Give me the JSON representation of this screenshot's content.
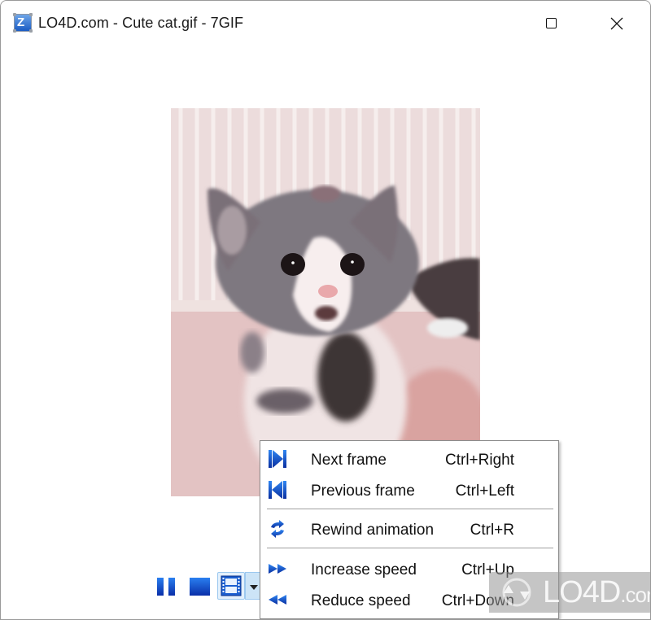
{
  "window": {
    "title": "LO4D.com - Cute cat.gif - 7GIF",
    "app_icon": "7gif-app-icon",
    "controls": [
      {
        "name": "maximize",
        "icon": "maximize-icon"
      },
      {
        "name": "close",
        "icon": "close-icon"
      }
    ]
  },
  "viewer": {
    "image_description": "Animated GIF of a grey and white kitten in front of a white wire cage"
  },
  "toolbar": {
    "buttons": [
      {
        "name": "pause",
        "icon": "pause-icon"
      },
      {
        "name": "stop",
        "icon": "stop-icon"
      },
      {
        "name": "frames",
        "icon": "film-strip-icon",
        "active": true
      },
      {
        "name": "frames-dropdown",
        "icon": "dropdown-arrow-icon"
      }
    ]
  },
  "context_menu": {
    "items": [
      {
        "label": "Next frame",
        "shortcut": "Ctrl+Right",
        "icon": "next-frame-icon"
      },
      {
        "label": "Previous frame",
        "shortcut": "Ctrl+Left",
        "icon": "previous-frame-icon"
      },
      {
        "separator": true
      },
      {
        "label": "Rewind animation",
        "shortcut": "Ctrl+R",
        "icon": "rewind-icon"
      },
      {
        "separator": true
      },
      {
        "label": "Increase speed",
        "shortcut": "Ctrl+Up",
        "icon": "fast-forward-icon"
      },
      {
        "label": "Reduce speed",
        "shortcut": "Ctrl+Down",
        "icon": "fast-rewind-icon"
      }
    ]
  },
  "watermark": {
    "brand": "LO4D",
    "suffix": ".com"
  },
  "colors": {
    "accent_blue": "#1455d0",
    "menu_border": "#8c8c8c",
    "toolbar_highlight": "#cce4f7"
  }
}
